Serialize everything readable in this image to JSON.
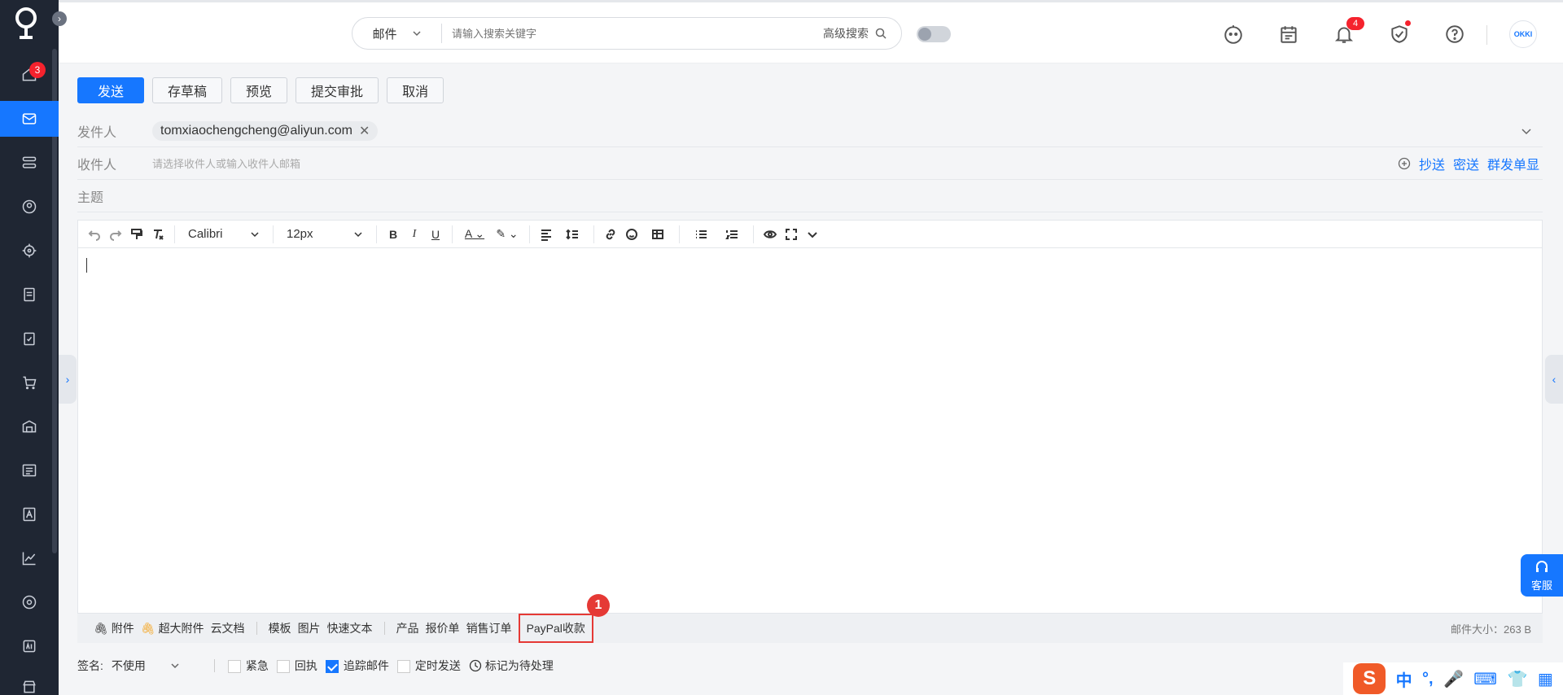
{
  "sidebar": {
    "home_badge": "3",
    "items": [
      {
        "icon": "home-icon"
      },
      {
        "icon": "mail-icon",
        "active": true
      },
      {
        "icon": "flow-icon"
      },
      {
        "icon": "contact-icon"
      },
      {
        "icon": "target-icon"
      },
      {
        "icon": "document-icon"
      },
      {
        "icon": "clipboard-icon"
      },
      {
        "icon": "cart-icon"
      },
      {
        "icon": "warehouse-icon"
      },
      {
        "icon": "list-icon"
      },
      {
        "icon": "font-icon"
      },
      {
        "icon": "chart-icon"
      },
      {
        "icon": "circle-target-icon"
      },
      {
        "icon": "ai-icon"
      },
      {
        "icon": "shop-icon"
      }
    ]
  },
  "header": {
    "search_scope": "邮件",
    "search_placeholder": "请输入搜索关键字",
    "advanced_search": "高级搜索",
    "notification_badge": "4",
    "avatar_text": "OKKI"
  },
  "toolbar": {
    "send": "发送",
    "save_draft": "存草稿",
    "preview": "预览",
    "submit_approval": "提交审批",
    "cancel": "取消"
  },
  "fields": {
    "sender_label": "发件人",
    "sender_value": "tomxiaochengcheng@aliyun.com",
    "recipient_label": "收件人",
    "recipient_placeholder": "请选择收件人或输入收件人邮箱",
    "cc": "抄送",
    "bcc": "密送",
    "group_single": "群发单显",
    "subject_label": "主题"
  },
  "editor": {
    "font_family": "Calibri",
    "font_size": "12px"
  },
  "attachments": {
    "attach": "附件",
    "large_attach": "超大附件",
    "cloud_doc": "云文档",
    "template": "模板",
    "image": "图片",
    "quick_text": "快速文本",
    "product": "产品",
    "quotation": "报价单",
    "sales_order": "销售订单",
    "paypal": "PayPal收款",
    "step_number": "1",
    "mail_size": "邮件大小：263 B"
  },
  "footer": {
    "signature_label": "签名:",
    "signature_value": "不使用",
    "urgent": "紧急",
    "receipt": "回执",
    "track_mail": "追踪邮件",
    "scheduled_send": "定时发送",
    "mark_pending": "标记为待处理"
  },
  "widgets": {
    "customer_service": "客服",
    "ime_chinese": "中",
    "ime_punct": "°,"
  }
}
